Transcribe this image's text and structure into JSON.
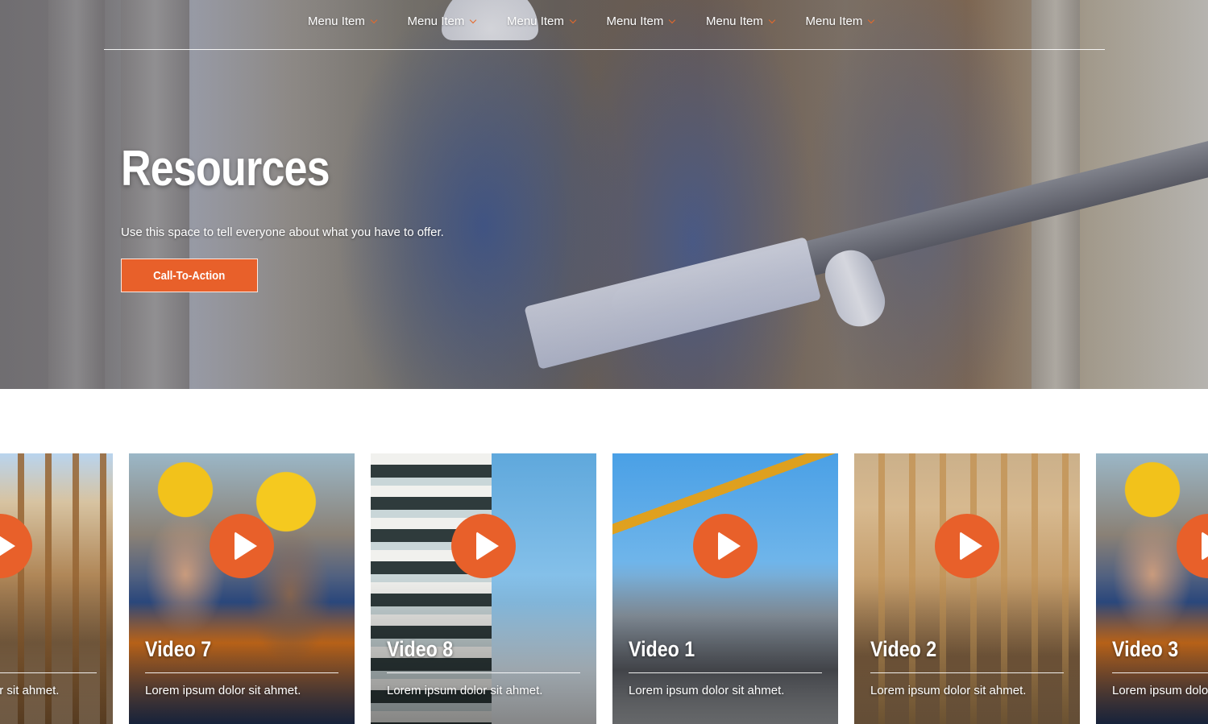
{
  "nav": {
    "items": [
      {
        "label": "Menu Item"
      },
      {
        "label": "Menu Item"
      },
      {
        "label": "Menu Item"
      },
      {
        "label": "Menu Item"
      },
      {
        "label": "Menu Item"
      },
      {
        "label": "Menu Item"
      }
    ]
  },
  "hero": {
    "title": "Resources",
    "subtitle": "Use this space to tell everyone about what you have to offer.",
    "cta_label": "Call-To-Action"
  },
  "videos": [
    {
      "title": "",
      "description": "Lorem ipsum dolor sit ahmet.",
      "image": "wood-frame-interior"
    },
    {
      "title": "Video 7",
      "description": "Lorem ipsum dolor sit ahmet.",
      "image": "workers-hardhats"
    },
    {
      "title": "Video 8",
      "description": "Lorem ipsum dolor sit ahmet.",
      "image": "building-facade"
    },
    {
      "title": "Video 1",
      "description": "Lorem ipsum dolor sit ahmet.",
      "image": "construction-crane"
    },
    {
      "title": "Video 2",
      "description": "Lorem ipsum dolor sit ahmet.",
      "image": "wood-frame-interior"
    },
    {
      "title": "Video 3",
      "description": "Lorem ipsum dolor sit ahmet.",
      "image": "workers-hardhats"
    }
  ],
  "colors": {
    "accent": "#e8602a",
    "text_on_image": "#ffffff"
  },
  "icons": {
    "nav_dropdown": "chevron-down-icon",
    "video_play": "play-icon"
  }
}
